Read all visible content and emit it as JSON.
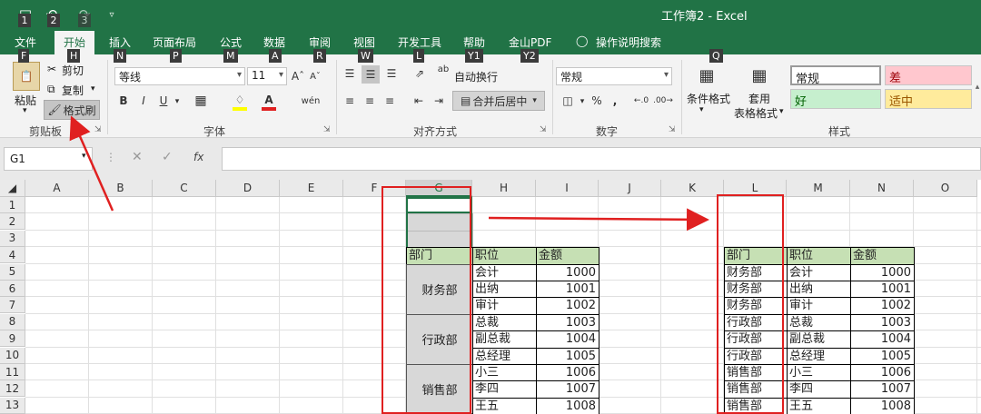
{
  "window": {
    "title": "工作簿2 - Excel",
    "qat_keytips": [
      "1",
      "2",
      "3"
    ]
  },
  "tabs": [
    {
      "label": "文件",
      "key": "F"
    },
    {
      "label": "开始",
      "key": "H"
    },
    {
      "label": "插入",
      "key": "N"
    },
    {
      "label": "页面布局",
      "key": "P"
    },
    {
      "label": "公式",
      "key": "M"
    },
    {
      "label": "数据",
      "key": "A"
    },
    {
      "label": "审阅",
      "key": "R"
    },
    {
      "label": "视图",
      "key": "W"
    },
    {
      "label": "开发工具",
      "key": "L"
    },
    {
      "label": "帮助",
      "key": "Y1"
    },
    {
      "label": "金山PDF",
      "key": "Y2"
    }
  ],
  "tell_me": {
    "label": "操作说明搜索",
    "key": "Q"
  },
  "ribbon": {
    "clipboard": {
      "paste": "粘贴",
      "cut": "剪切",
      "copy": "复制",
      "format_painter": "格式刷",
      "group": "剪贴板"
    },
    "font": {
      "name": "等线",
      "size": "11",
      "bold": "B",
      "italic": "I",
      "underline": "U",
      "group": "字体"
    },
    "alignment": {
      "wrap": "自动换行",
      "merge": "合并后居中",
      "group": "对齐方式"
    },
    "number": {
      "format": "常规",
      "percent": "%",
      "comma": ",",
      "group": "数字"
    },
    "styles": {
      "conditional": "条件格式",
      "table_line1": "套用",
      "table_line2": "表格格式",
      "normal": "常规",
      "bad": "差",
      "good": "好",
      "neutral": "适中",
      "group": "样式"
    }
  },
  "formula_bar": {
    "name_box": "G1",
    "fx": "fx",
    "formula": ""
  },
  "columns": [
    "A",
    "B",
    "C",
    "D",
    "E",
    "F",
    "G",
    "H",
    "I",
    "J",
    "K",
    "L",
    "M",
    "N",
    "O"
  ],
  "selected_column": "G",
  "rows": [
    "1",
    "2",
    "3",
    "4",
    "5",
    "6",
    "7",
    "8",
    "9",
    "10",
    "11",
    "12",
    "13"
  ],
  "left_table": {
    "headers": [
      "部门",
      "职位",
      "金额"
    ],
    "merged_departments": [
      "财务部",
      "行政部",
      "销售部"
    ],
    "positions": [
      "会计",
      "出纳",
      "审计",
      "总裁",
      "副总裁",
      "总经理",
      "小三",
      "李四",
      "王五"
    ],
    "amounts": [
      "1000",
      "1001",
      "1002",
      "1003",
      "1004",
      "1005",
      "1006",
      "1007",
      "1008"
    ]
  },
  "right_table": {
    "headers": [
      "部门",
      "职位",
      "金额"
    ],
    "departments": [
      "财务部",
      "财务部",
      "财务部",
      "行政部",
      "行政部",
      "行政部",
      "销售部",
      "销售部",
      "销售部"
    ],
    "positions": [
      "会计",
      "出纳",
      "审计",
      "总裁",
      "副总裁",
      "总经理",
      "小三",
      "李四",
      "王五"
    ],
    "amounts": [
      "1000",
      "1001",
      "1002",
      "1003",
      "1004",
      "1005",
      "1006",
      "1007",
      "1008"
    ]
  },
  "colors": {
    "excel_green": "#217346",
    "header_fill": "#c6e0b4",
    "annotation_red": "#e02020",
    "bad_fill": "#ffc7ce",
    "good_fill": "#c6efce",
    "neutral_fill": "#ffeb9c"
  }
}
